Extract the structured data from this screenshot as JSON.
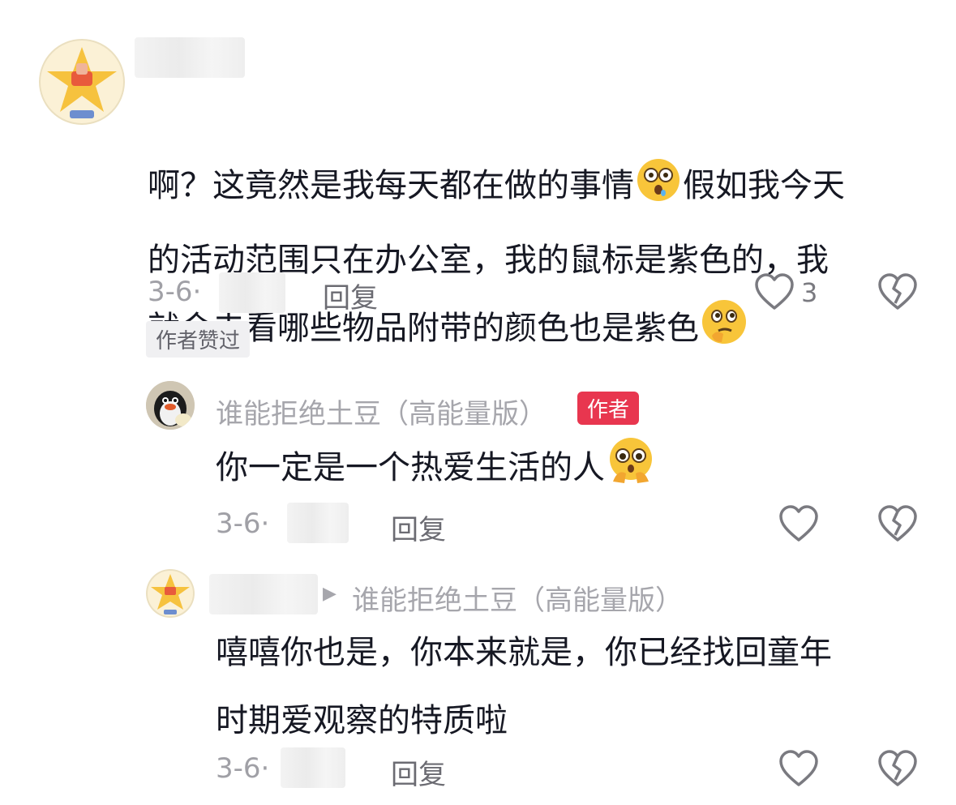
{
  "comments": [
    {
      "lines": [
        "啊？这竟然是我每天都在做的事情",
        "假如我今天",
        "的活动范围只在办公室，我的鼠标是紫色的，我",
        "就会去看哪些物品附带的颜色也是紫色"
      ],
      "emoji1": "flushed-emoji",
      "emoji2": "thinking-emoji",
      "date": "3-6·",
      "reply_label": "回复",
      "like_count": "3",
      "author_liked_badge": "作者赞过"
    },
    {
      "author_name": "谁能拒绝土豆（高能量版）",
      "author_badge": "作者",
      "text": "你一定是一个热爱生活的人",
      "emoji": "pleading-emoji",
      "date": "3-6·",
      "reply_label": "回复"
    },
    {
      "reply_to_arrow": "▶",
      "reply_to_name": "谁能拒绝土豆（高能量版）",
      "lines": [
        "嘻嘻你也是，你本来就是，你已经找回童年",
        "时期爱观察的特质啦"
      ],
      "date": "3-6·",
      "reply_label": "回复"
    }
  ],
  "colors": {
    "author_badge_bg": "#e8364f",
    "secondary_text": "#a0a0a6"
  }
}
